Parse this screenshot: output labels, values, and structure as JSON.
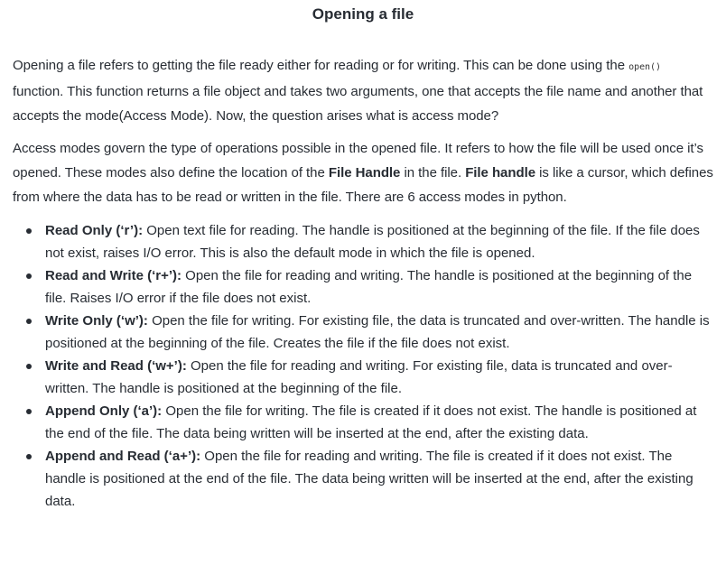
{
  "title": "Opening a file",
  "para1": {
    "text_before": "Opening a file refers to getting the file ready either for reading or for writing. This can be done using the ",
    "code": "open()",
    "text_after": " function. This function returns a file object and takes two arguments, one that accepts the file name and another that accepts the mode(Access Mode). Now, the question arises what is access mode?"
  },
  "para2": {
    "t1": "Access modes govern the type of operations possible in the opened file. It refers to how the file will be used once it’s opened. These modes also define the location of the ",
    "b1": "File Handle",
    "t2": " in the file. ",
    "b2": "File handle",
    "t3": " is like a cursor, which defines from where the data has to be read or written in the file. There are 6 access modes in python."
  },
  "modes": [
    {
      "name": "Read Only (‘r’):",
      "desc": " Open text file for reading. The handle is positioned at the beginning of the file. If the file does not exist, raises I/O error. This is also the default mode in which the file is opened."
    },
    {
      "name": "Read and Write (‘r+’):",
      "desc": " Open the file for reading and writing. The handle is positioned at the beginning of the file. Raises I/O error if the file does not exist."
    },
    {
      "name": "Write Only (‘w’):",
      "desc": " Open the file for writing. For existing file, the data is truncated and over-written. The handle is positioned at the beginning of the file. Creates the file if the file does not exist."
    },
    {
      "name": "Write and Read (‘w+’):",
      "desc": " Open the file for reading and writing. For existing file, data is truncated and over-written. The handle is positioned at the beginning of the file."
    },
    {
      "name": "Append Only (‘a’):",
      "desc": " Open the file for writing. The file is created if it does not exist. The handle is positioned at the end of the file. The data being written will be inserted at the end, after the existing data."
    },
    {
      "name": "Append and Read (‘a+’):",
      "desc": " Open the file for reading and writing. The file is created if it does not exist. The handle is positioned at the end of the file. The data being written will be inserted at the end, after the existing data."
    }
  ]
}
